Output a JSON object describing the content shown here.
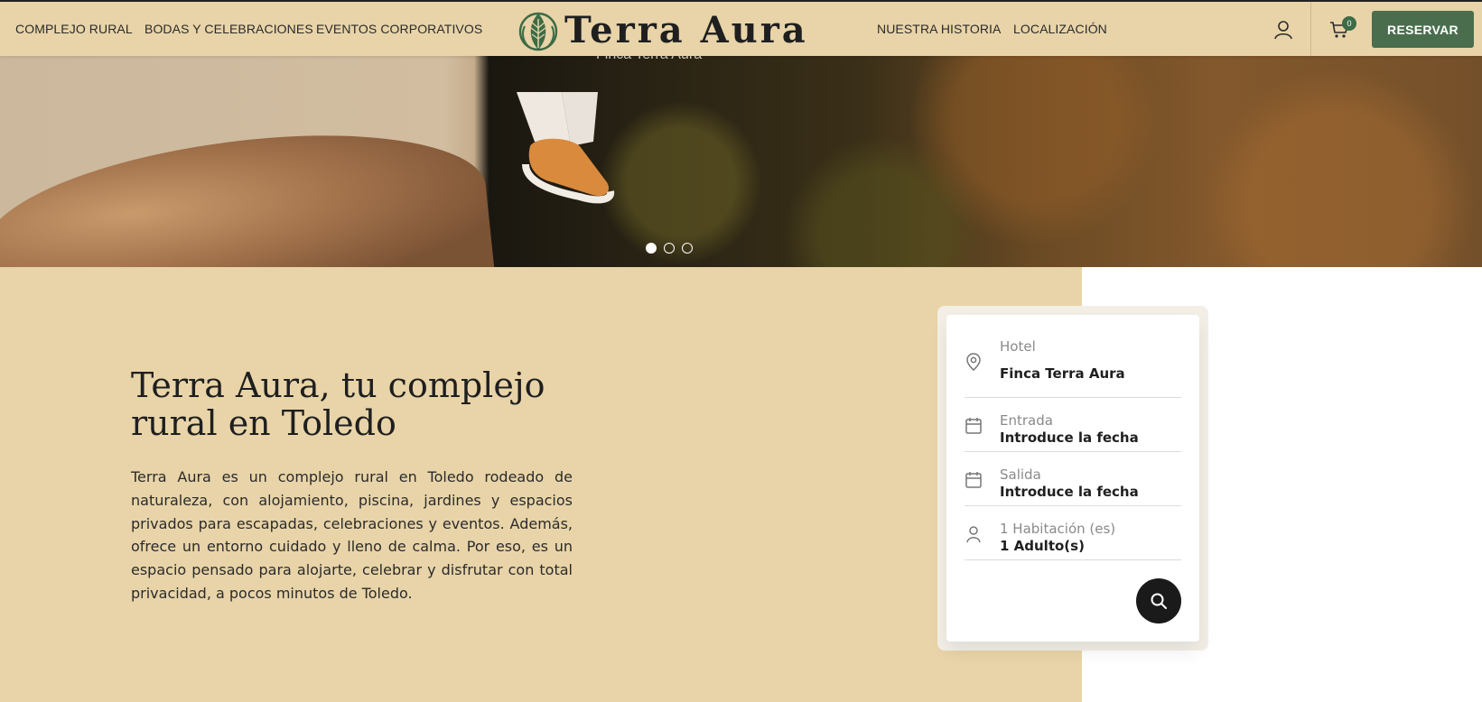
{
  "header": {
    "nav_left": [
      "COMPLEJO RURAL",
      "BODAS Y CELEBRACIONES",
      "EVENTOS CORPORATIVOS"
    ],
    "logo_text": "Terra Aura",
    "nav_right": [
      "NUESTRA HISTORIA",
      "LOCALIZACIÓN"
    ],
    "cart_count": "0",
    "reservar_label": "RESERVAR",
    "icons": [
      "leaf-logo-icon",
      "user-icon",
      "cart-icon"
    ]
  },
  "hero": {
    "caption": "Finca Terra Aura",
    "slides": 3,
    "active_slide": 1
  },
  "intro": {
    "title": "Terra Aura, tu complejo rural en Toledo",
    "description": "Terra Aura es un complejo rural en Toledo rodeado de naturaleza, con alojamiento, piscina, jardines y espacios privados para escapadas, celebraciones y eventos. Además, ofrece un entorno cuidado y lleno de calma. Por eso, es un espacio pensado para alojarte, celebrar y disfrutar con total privacidad, a pocos minutos de Toledo."
  },
  "booking": {
    "hotel_label": "Hotel",
    "hotel_value": "Finca Terra Aura",
    "checkin_label": "Entrada",
    "checkin_value": "Introduce la fecha",
    "checkout_label": "Salida",
    "checkout_value": "Introduce la fecha",
    "rooms_label": "1 Habitación (es)",
    "guests_value": "1 Adulto(s)"
  },
  "colors": {
    "sand": "#e8d4a8",
    "brand_green": "#4a6e4d",
    "badge_green": "#3d6b45",
    "dark": "#1a1a1a"
  }
}
